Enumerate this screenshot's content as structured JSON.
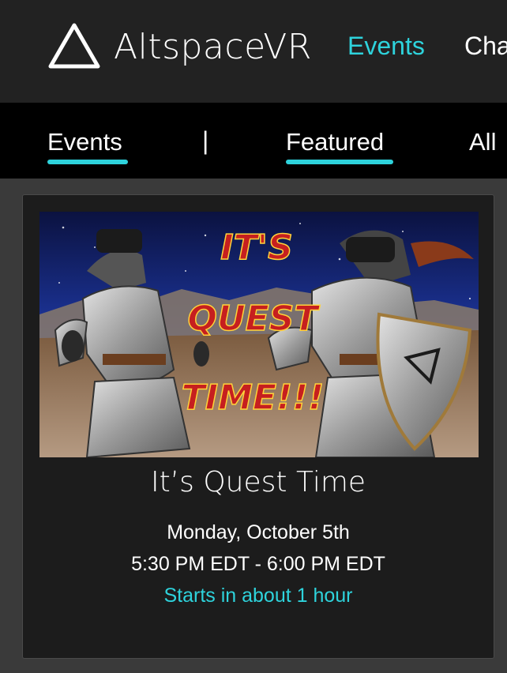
{
  "header": {
    "brand": "AltspaceVR",
    "nav": [
      {
        "label": "Events"
      },
      {
        "label": "Cha"
      }
    ]
  },
  "subnav": {
    "tabs": [
      {
        "label": "Events"
      },
      {
        "label": "Featured"
      },
      {
        "label": "All"
      }
    ],
    "separator": "|"
  },
  "event": {
    "image_text": [
      "IT'S",
      "QUEST",
      "TIME!!!"
    ],
    "title": "It’s Quest Time",
    "date": "Monday, October 5th",
    "time": "5:30 PM EDT - 6:00 PM EDT",
    "starts": "Starts in about 1 hour"
  },
  "colors": {
    "accent": "#2ed3dc",
    "header_bg": "#222222",
    "subnav_bg": "#000000",
    "card_bg": "#1c1c1c",
    "page_bg": "#3a3a3a"
  }
}
